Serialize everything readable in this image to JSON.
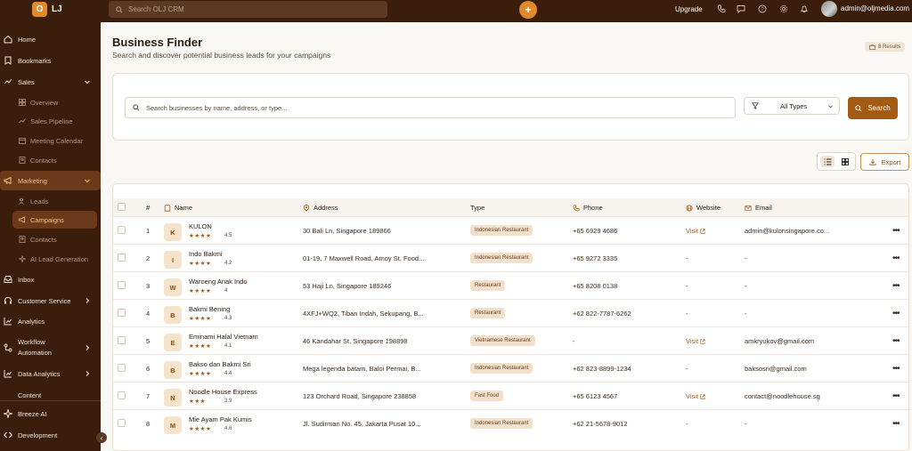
{
  "topbar": {
    "logo_letter": "O",
    "logo_text": "LJ",
    "search_placeholder": "Search OLJ CRM",
    "upgrade_label": "Upgrade",
    "user_email": "admin@oljmedia.com"
  },
  "sidebar": {
    "home": "Home",
    "bookmarks": "Bookmarks",
    "sales": "Sales",
    "sales_items": [
      "Overview",
      "Sales Pipeline",
      "Meeting Calendar",
      "Contacts"
    ],
    "marketing": "Marketing",
    "marketing_items": [
      "Leads",
      "Campaigns",
      "Contacts",
      "AI Lead Generation"
    ],
    "inbox": "Inbox",
    "customer_service": "Customer Service",
    "analytics": "Analytics",
    "workflow_line1": "Workflow",
    "workflow_line2": "Automation",
    "data_analytics": "Data Analytics",
    "content": "Content",
    "breeze_ai": "Breeze AI",
    "development": "Development"
  },
  "page": {
    "title": "Business Finder",
    "subtitle": "Search and discover potential business leads for your campaigns",
    "results": "8 Results"
  },
  "finder": {
    "search_placeholder": "Search businesses by name, address, or type...",
    "type_selected": "All Types",
    "search_button": "Search",
    "export_button": "Export"
  },
  "table": {
    "headers": {
      "num": "#",
      "name": "Name",
      "address": "Address",
      "type": "Type",
      "phone": "Phone",
      "website": "Website",
      "email": "Email"
    },
    "rows": [
      {
        "num": "1",
        "initial": "K",
        "name": "KULON",
        "stars": "★★★★",
        "rating": "4.5",
        "address": "30 Bali Ln, Singapore 189866",
        "type": "Indonesian Restaurant",
        "phone": "+65 6929 4686",
        "website": "Visit",
        "email": "admin@kulonsingapore.co..."
      },
      {
        "num": "2",
        "initial": "I",
        "name": "Indo Bakmi",
        "stars": "★★★★",
        "rating": "4.2",
        "address": "01-19, 7 Maxwell Road, Amoy St, Food...",
        "type": "Indonesian Restaurant",
        "phone": "+65 9272 3335",
        "website": "-",
        "email": "-"
      },
      {
        "num": "3",
        "initial": "W",
        "name": "Waroeng Anak Indo",
        "stars": "★★★★",
        "rating": "4",
        "address": "53 Haji Ln, Singapore 189246",
        "type": "Restaurant",
        "phone": "+65 8208 0138",
        "website": "-",
        "email": "-"
      },
      {
        "num": "4",
        "initial": "B",
        "name": "Bakmi Bening",
        "stars": "★★★★",
        "rating": "4.3",
        "address": "4XFJ+WQ2, Tiban Indah, Sekupang, B...",
        "type": "Restaurant",
        "phone": "+62 822-7787-6262",
        "website": "-",
        "email": "-"
      },
      {
        "num": "5",
        "initial": "E",
        "name": "Eminami Halal Vietnam",
        "stars": "★★★★",
        "rating": "4.1",
        "address": "46 Kandahar St, Singapore 198898",
        "type": "Vietnamese Restaurant",
        "phone": "-",
        "website": "Visit",
        "email": "amkryukov@gmail.com"
      },
      {
        "num": "6",
        "initial": "B",
        "name": "Bakso dan Bakmi Sri",
        "stars": "★★★★",
        "rating": "4.4",
        "address": "Mega legenda batam, Baloi Permai, B...",
        "type": "Indonesian Restaurant",
        "phone": "+62 823-8899-1234",
        "website": "-",
        "email": "baksosri@gmail.com"
      },
      {
        "num": "7",
        "initial": "N",
        "name": "Noodle House Express",
        "stars": "★★★",
        "rating": "3.9",
        "address": "123 Orchard Road, Singapore 238858",
        "type": "Fast Food",
        "phone": "+65 6123 4567",
        "website": "Visit",
        "email": "contact@noodlehouse.sg"
      },
      {
        "num": "8",
        "initial": "M",
        "name": "Mie Ayam Pak Kumis",
        "stars": "★★★★",
        "rating": "4.6",
        "address": "Jl. Sudirman No. 45, Jakarta Pusat 10...",
        "type": "Indonesian Restaurant",
        "phone": "+62 21-5678-9012",
        "website": "-",
        "email": "-"
      }
    ]
  },
  "colors": {
    "brand_dark": "#3b1d0b",
    "accent": "#e08a2c",
    "button": "#a35a11"
  }
}
